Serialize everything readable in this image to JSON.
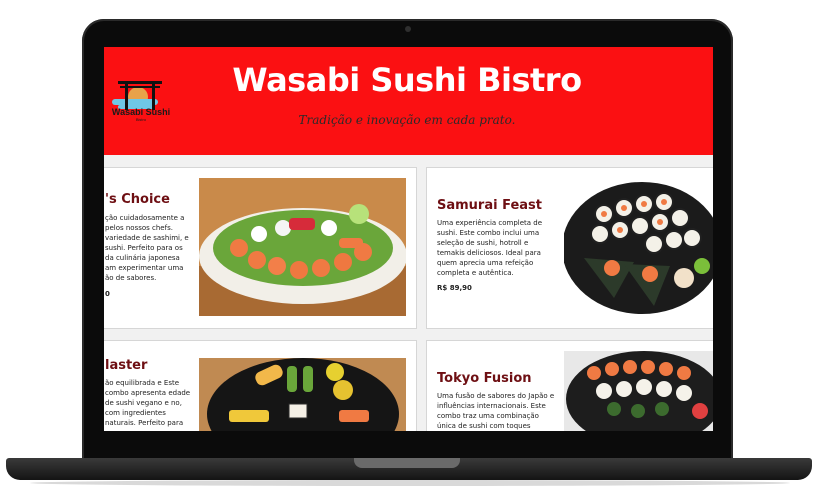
{
  "header": {
    "logo_text": "Wasabi Sushi",
    "logo_sub": "Bistro",
    "title": "Wasabi Sushi Bistro",
    "tagline": "Tradição e inovação em cada prato."
  },
  "cards": [
    {
      "title": "'s Choice",
      "description": "ção cuidadosamente a pelos nossos chefs. variedade de sashimi, e sushi. Perfeito para os da culinária japonesa am experimentar uma ão de sabores.",
      "price": "0"
    },
    {
      "title": "Samurai Feast",
      "description": "Uma experiência completa de sushi. Este combo inclui uma seleção de sushi, hotroll e temakis deliciosos. Ideal para quem aprecia uma refeição completa e autêntica.",
      "price": "R$ 89,90"
    },
    {
      "title": "laster",
      "description": "ão equilibrada e Este combo apresenta edade de sushi vegano e no, com ingredientes naturais. Perfeito para",
      "price": ""
    },
    {
      "title": "Tokyo Fusion",
      "description": "Uma fusão de sabores do Japão e influências internacionais. Este combo traz uma combinação única de sushi com toques",
      "price": ""
    }
  ],
  "colors": {
    "header_red": "#fb1012",
    "title_maroon": "#6e0f13"
  }
}
